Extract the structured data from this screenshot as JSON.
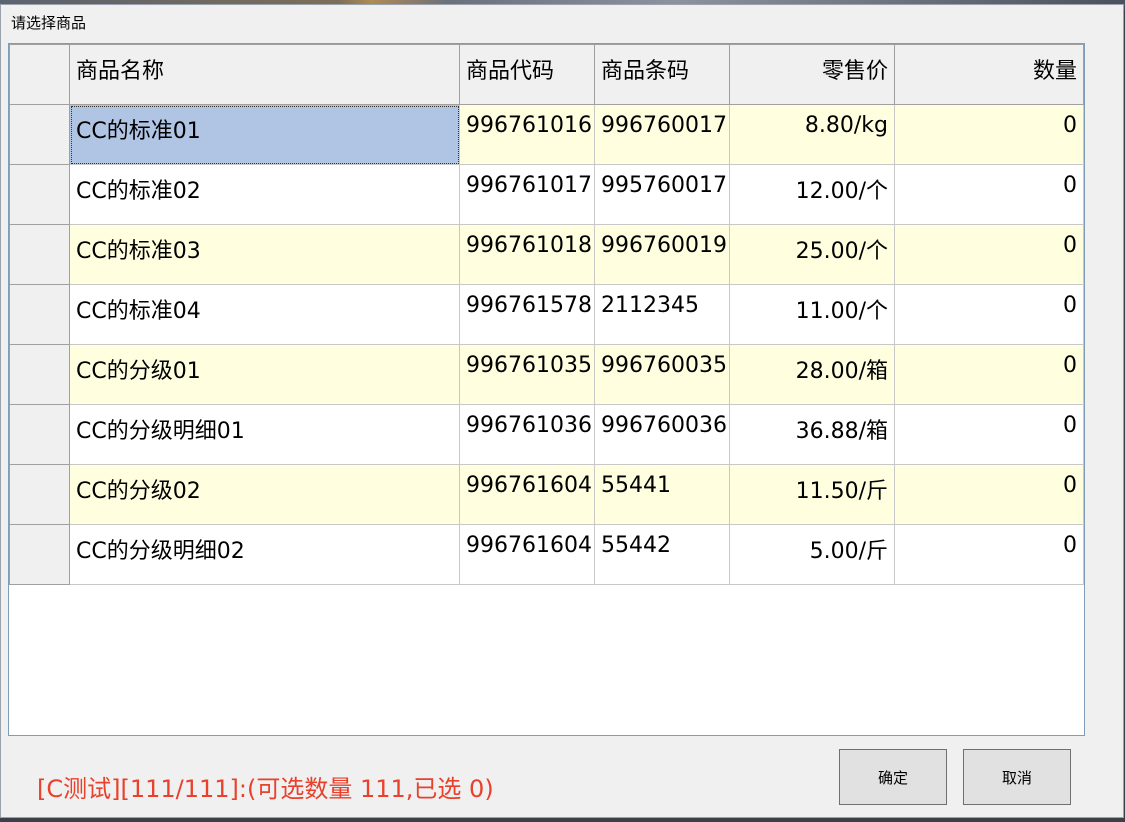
{
  "window": {
    "title": "请选择商品"
  },
  "table": {
    "headers": [
      "",
      "商品名称",
      "商品代码",
      "商品条码",
      "零售价",
      "数量"
    ],
    "rows": [
      {
        "name": "CC的标准01",
        "code": "996761016",
        "barcode": "996760017",
        "price": "8.80/kg",
        "qty": "0",
        "selected": true
      },
      {
        "name": "CC的标准02",
        "code": "996761017",
        "barcode": "995760017",
        "price": "12.00/个",
        "qty": "0"
      },
      {
        "name": "CC的标准03",
        "code": "996761018",
        "barcode": "996760019",
        "price": "25.00/个",
        "qty": "0"
      },
      {
        "name": "CC的标准04",
        "code": "996761578",
        "barcode": "2112345",
        "price": "11.00/个",
        "qty": "0"
      },
      {
        "name": "CC的分级01",
        "code": "996761035",
        "barcode": "996760035",
        "price": "28.00/箱",
        "qty": "0"
      },
      {
        "name": "CC的分级明细01",
        "code": "996761036",
        "barcode": "996760036",
        "price": "36.88/箱",
        "qty": "0"
      },
      {
        "name": "CC的分级02",
        "code": "996761604",
        "barcode": "55441",
        "price": "11.50/斤",
        "qty": "0"
      },
      {
        "name": "CC的分级明细02",
        "code": "996761604",
        "barcode": "55442",
        "price": "5.00/斤",
        "qty": "0"
      }
    ]
  },
  "status": {
    "text": "[C测试][111/111]:(可选数量 111,已选 0)",
    "color": "#e8412c"
  },
  "buttons": {
    "ok": "确定",
    "cancel": "取消"
  }
}
